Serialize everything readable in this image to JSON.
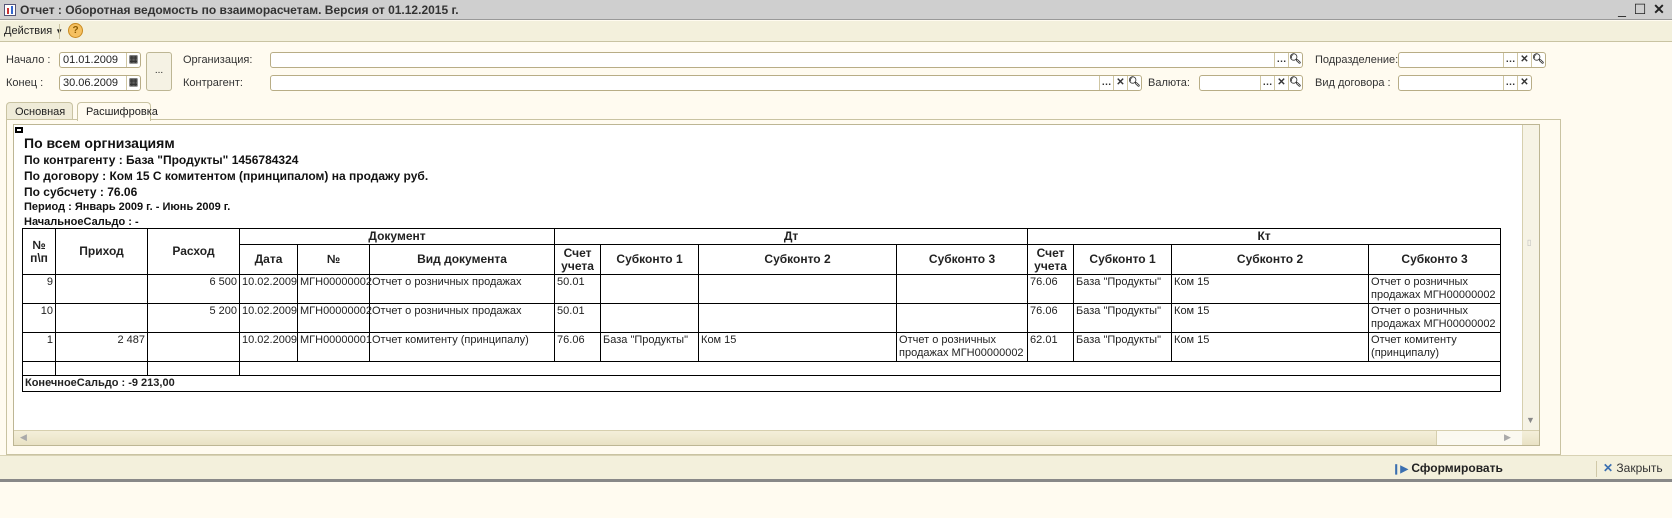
{
  "window": {
    "title": "Отчет : Оборотная ведомость по взаиморасчетам. Версия от 01.12.2015 г."
  },
  "toolbar": {
    "actions_label": "Действия",
    "help_icon": "?"
  },
  "filters": {
    "start_label": "Начало :",
    "start_value": "01.01.2009",
    "end_label": "Конец :",
    "end_value": "30.06.2009",
    "period_button": "...",
    "org_label": "Организация:",
    "org_value": "",
    "counterparty_label": "Контрагент:",
    "counterparty_value": "",
    "currency_label": "Валюта:",
    "currency_value": "",
    "division_label": "Подразделение:",
    "division_value": "",
    "contract_type_label": "Вид договора :",
    "contract_type_value": ""
  },
  "tabs": [
    {
      "label": "Основная"
    },
    {
      "label": "Расшифровка"
    }
  ],
  "report": {
    "header1": "По всем оргнизациям",
    "header2": "По контрагенту : База \"Продукты\" 1456784324",
    "header3": "По договору : Ком 15 С комитентом (принципалом) на продажу руб.",
    "header4": "По субсчету : 76.06",
    "period": "Период : Январь 2009 г. - Июнь 2009 г.",
    "opening": "НачальноеСальдо : -",
    "closing": "КонечноеСальдо : -9 213,00",
    "columns": {
      "num": "№ п\\п",
      "income": "Приход",
      "expense": "Расход",
      "document": "Документ",
      "date": "Дата",
      "docnum": "№",
      "doctype": "Вид документа",
      "dt": "Дт",
      "kt": "Кт",
      "account": "Счет учета",
      "sub1": "Субконто 1",
      "sub2": "Субконто 2",
      "sub3": "Субконто 3"
    },
    "rows": [
      {
        "n": "9",
        "income": "",
        "expense": "6 500",
        "date": "10.02.2009",
        "docnum": "МГН00000002",
        "doctype": "Отчет о розничных продажах",
        "dt_acc": "50.01",
        "dt_s1": "",
        "dt_s2": "",
        "dt_s3": "",
        "kt_acc": "76.06",
        "kt_s1": "База \"Продукты\"",
        "kt_s2": "Ком 15",
        "kt_s3": "Отчет о розничных продажах МГН00000002"
      },
      {
        "n": "10",
        "income": "",
        "expense": "5 200",
        "date": "10.02.2009",
        "docnum": "МГН00000002",
        "doctype": "Отчет о розничных продажах",
        "dt_acc": "50.01",
        "dt_s1": "",
        "dt_s2": "",
        "dt_s3": "",
        "kt_acc": "76.06",
        "kt_s1": "База \"Продукты\"",
        "kt_s2": "Ком 15",
        "kt_s3": "Отчет о розничных продажах МГН00000002"
      },
      {
        "n": "1",
        "income": "2 487",
        "expense": "",
        "date": "10.02.2009",
        "docnum": "МГН00000001",
        "doctype": "Отчет комитенту (принципалу)",
        "dt_acc": "76.06",
        "dt_s1": "База \"Продукты\"",
        "dt_s2": "Ком 15",
        "dt_s3": "Отчет о розничных продажах МГН00000002",
        "kt_acc": "62.01",
        "kt_s1": "База \"Продукты\"",
        "kt_s2": "Ком 15",
        "kt_s3": "Отчет комитенту (принципалу)"
      }
    ]
  },
  "bottom": {
    "generate_label": "Сформировать",
    "close_label": "Закрыть"
  }
}
